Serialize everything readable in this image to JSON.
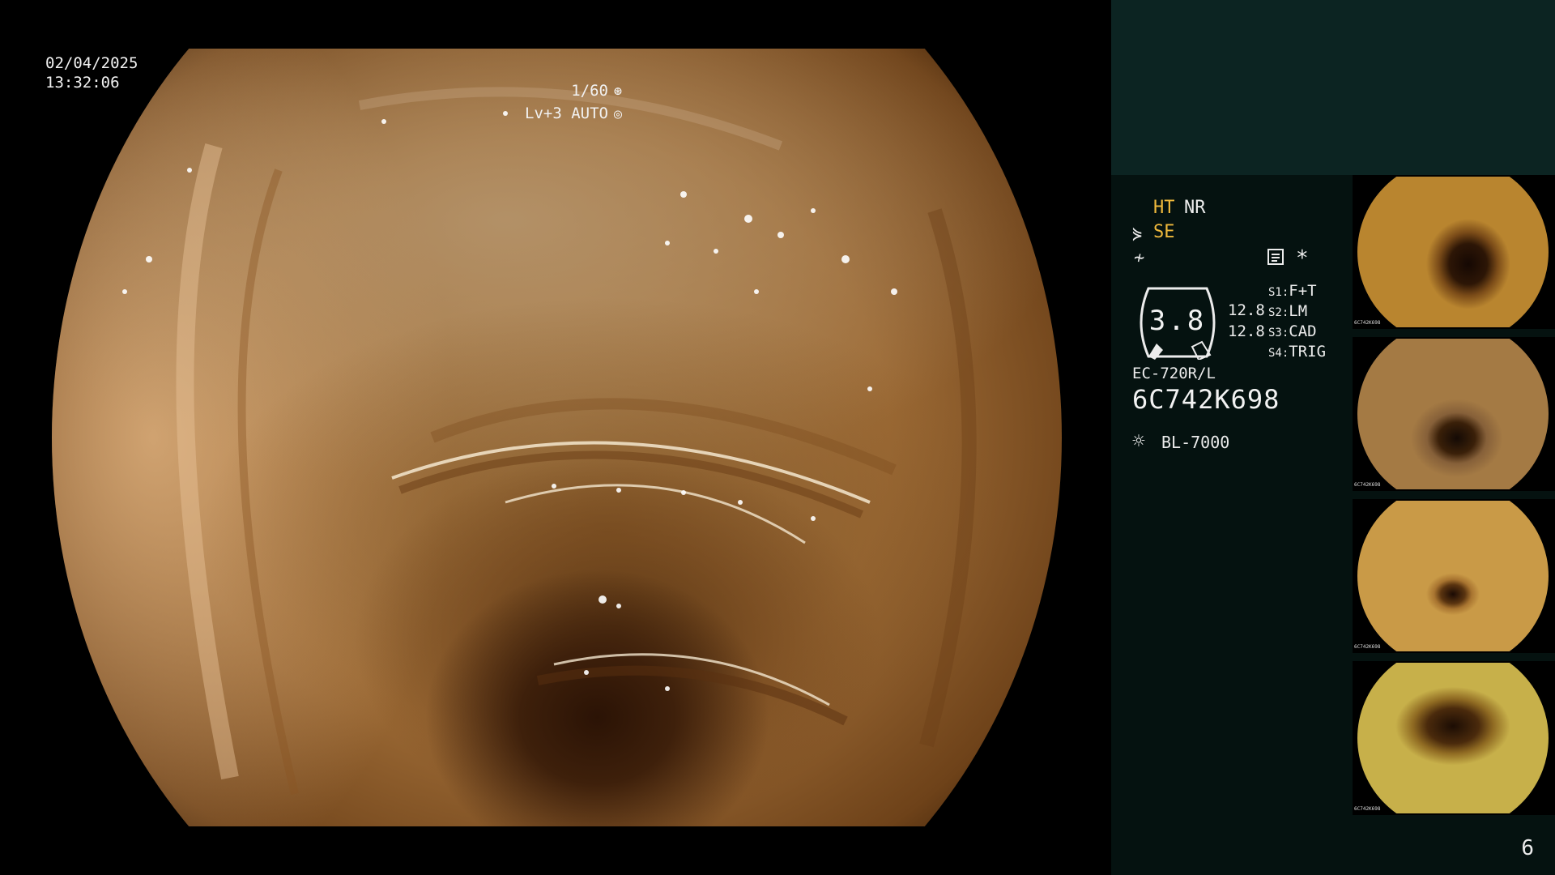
{
  "main": {
    "date": "02/04/2025",
    "time": "13:32:06",
    "shutter": "1/60",
    "shutter_icon": "aperture-icon",
    "level": "Lv+3 AUTO",
    "level_icon": "iris-icon"
  },
  "panel": {
    "ht": "HT",
    "nr": "NR",
    "se": "SE",
    "se_icon": "structure-enhance-icon",
    "ff_icon": "freeze-icon",
    "memo_icon": "memo-icon",
    "star": "*",
    "gauge_value": "3.8",
    "side_value_1": "12.8",
    "side_value_2": "12.8",
    "switches": [
      {
        "key": "S1:",
        "value": "F+T"
      },
      {
        "key": "S2:",
        "value": "LM"
      },
      {
        "key": "S3:",
        "value": "CAD"
      },
      {
        "key": "S4:",
        "value": "TRIG"
      }
    ],
    "scope_model": "EC-720R/L",
    "serial": "6C742K698",
    "lamp_icon": "light-source-icon",
    "lamp": "BL-7000"
  },
  "thumbnails": [
    {
      "name": "capture-1",
      "serial": "6C742K698"
    },
    {
      "name": "capture-2",
      "serial": "6C742K698"
    },
    {
      "name": "capture-3",
      "serial": "6C742K698"
    },
    {
      "name": "capture-4",
      "serial": "6C742K698"
    }
  ],
  "page_number": "6",
  "colors": {
    "panel_bg": "#051210",
    "header_bg": "#0c2422",
    "accent_orange": "#f0b93c",
    "text": "#ececec"
  }
}
